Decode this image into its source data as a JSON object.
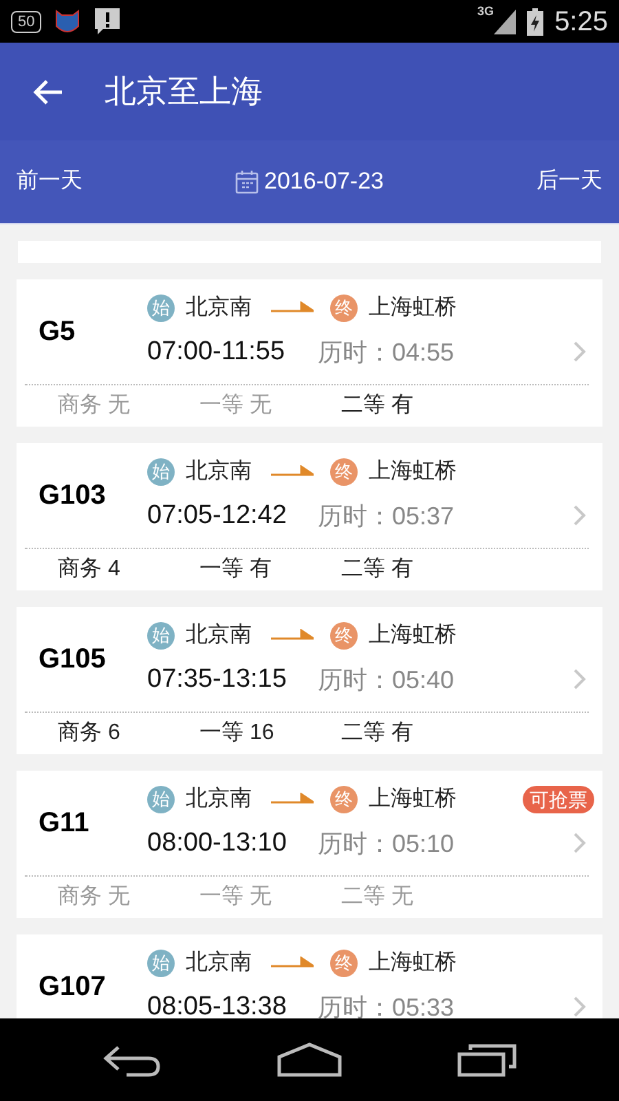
{
  "status_bar": {
    "time": "5:25",
    "notification_badge": "50",
    "network": "3G"
  },
  "app_bar": {
    "title": "北京至上海"
  },
  "date_bar": {
    "previous": "前一天",
    "date": "2016-07-23",
    "next": "后一天"
  },
  "trains": [
    {
      "number": "G5",
      "from_mark": "始",
      "from": "北京南",
      "to_mark": "终",
      "to": "上海虹桥",
      "times": "07:00-11:55",
      "duration": "历时：04:55",
      "seats": [
        {
          "label": "商务 无",
          "available": false
        },
        {
          "label": "一等 无",
          "available": false
        },
        {
          "label": "二等 有",
          "available": true
        }
      ]
    },
    {
      "number": "G103",
      "from_mark": "始",
      "from": "北京南",
      "to_mark": "终",
      "to": "上海虹桥",
      "times": "07:05-12:42",
      "duration": "历时：05:37",
      "seats": [
        {
          "label": "商务 4",
          "available": true
        },
        {
          "label": "一等 有",
          "available": true
        },
        {
          "label": "二等 有",
          "available": true
        }
      ]
    },
    {
      "number": "G105",
      "from_mark": "始",
      "from": "北京南",
      "to_mark": "终",
      "to": "上海虹桥",
      "times": "07:35-13:15",
      "duration": "历时：05:40",
      "seats": [
        {
          "label": "商务 6",
          "available": true
        },
        {
          "label": "一等 16",
          "available": true
        },
        {
          "label": "二等 有",
          "available": true
        }
      ]
    },
    {
      "number": "G11",
      "from_mark": "始",
      "from": "北京南",
      "to_mark": "终",
      "to": "上海虹桥",
      "times": "08:00-13:10",
      "duration": "历时：05:10",
      "badge": "可抢票",
      "seats": [
        {
          "label": "商务 无",
          "available": false
        },
        {
          "label": "一等 无",
          "available": false
        },
        {
          "label": "二等 无",
          "available": false
        }
      ]
    },
    {
      "number": "G107",
      "from_mark": "始",
      "from": "北京南",
      "to_mark": "终",
      "to": "上海虹桥",
      "times": "08:05-13:38",
      "duration": "历时：05:33"
    }
  ]
}
